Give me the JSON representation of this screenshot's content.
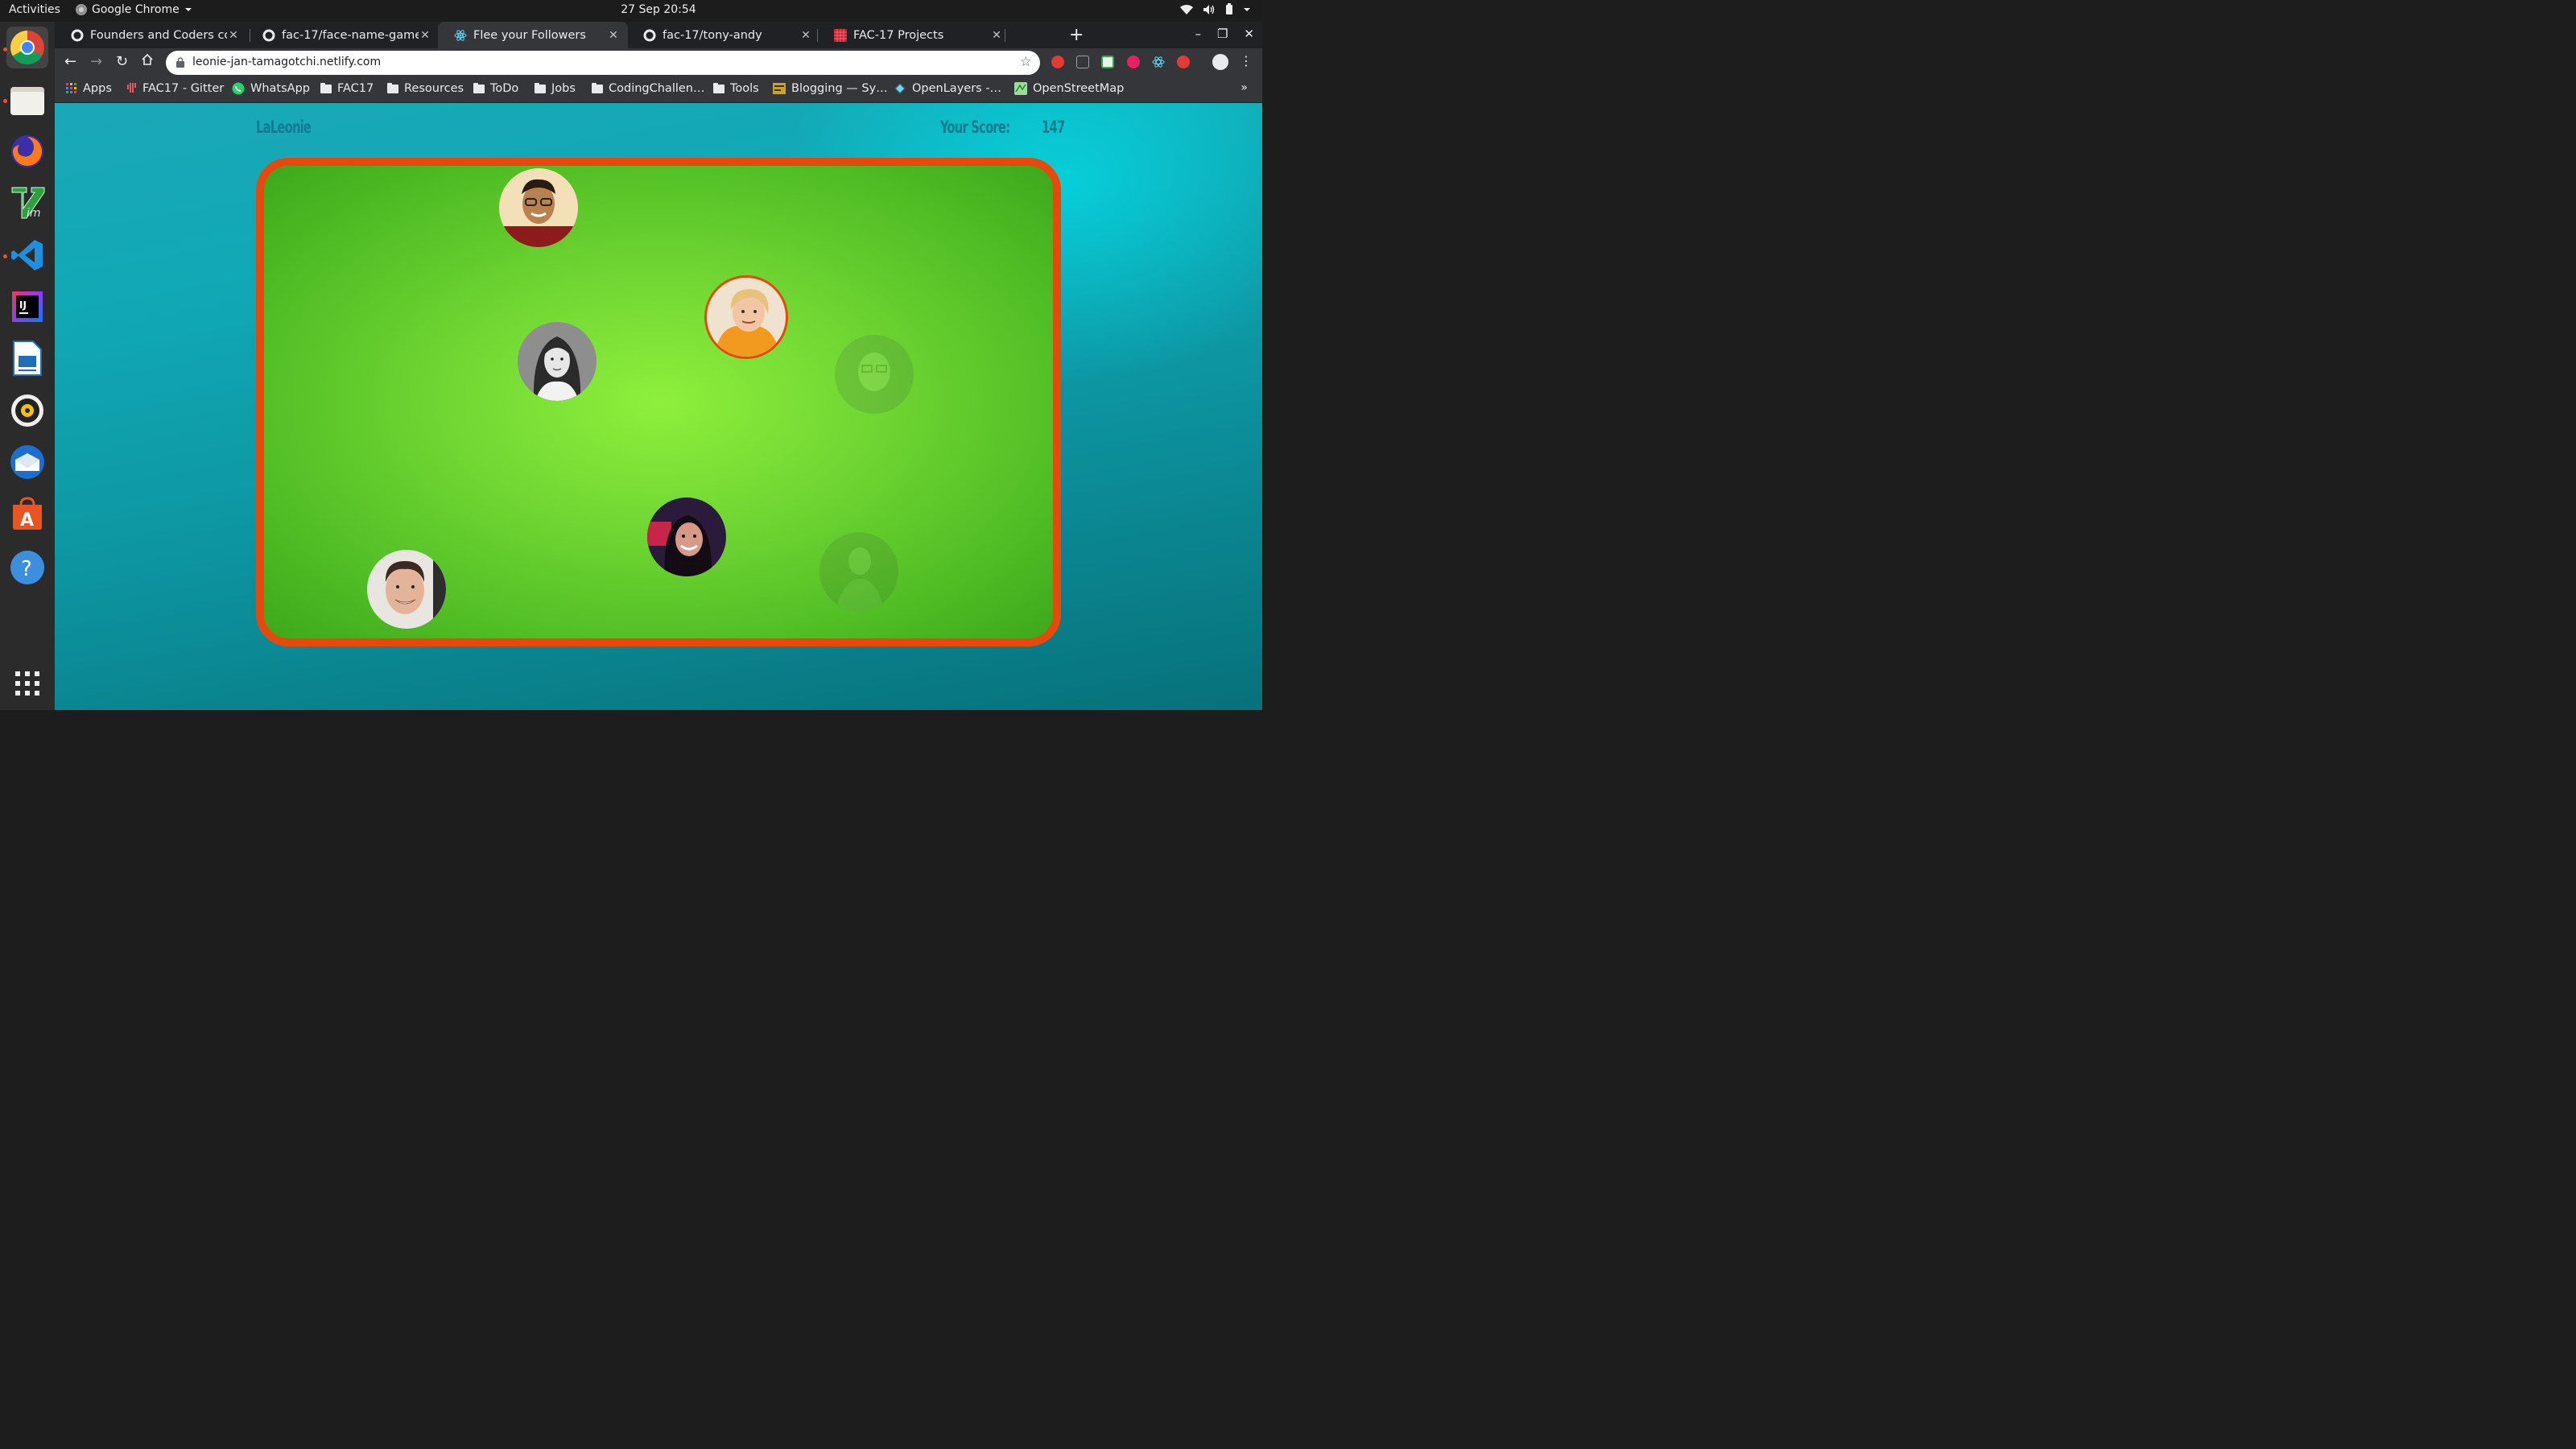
{
  "os": {
    "activities": "Activities",
    "app_name": "Google Chrome",
    "datetime": "27 Sep  20:54"
  },
  "tabs": [
    {
      "title": "Founders and Coders coh",
      "icon": "github-icon",
      "active": false
    },
    {
      "title": "fac-17/face-name-game",
      "icon": "github-icon",
      "active": false
    },
    {
      "title": "Flee your Followers",
      "icon": "react-icon",
      "active": true
    },
    {
      "title": "fac-17/tony-andy",
      "icon": "github-icon",
      "active": false
    },
    {
      "title": "FAC-17 Projects",
      "icon": "grid-icon",
      "active": false
    }
  ],
  "address": {
    "url": "leonie-jan-tamagotchi.netlify.com"
  },
  "bookmarks": [
    {
      "label": "Apps",
      "icon": "apps-grid-icon"
    },
    {
      "label": "FAC17 - Gitter",
      "icon": "gitter-icon"
    },
    {
      "label": "WhatsApp",
      "icon": "whatsapp-icon"
    },
    {
      "label": "FAC17",
      "icon": "folder-icon"
    },
    {
      "label": "Resources",
      "icon": "folder-icon"
    },
    {
      "label": "ToDo",
      "icon": "folder-icon"
    },
    {
      "label": "Jobs",
      "icon": "folder-icon"
    },
    {
      "label": "CodingChallen…",
      "icon": "folder-icon"
    },
    {
      "label": "Tools",
      "icon": "folder-icon"
    },
    {
      "label": "Blogging — Sy…",
      "icon": "blog-icon"
    },
    {
      "label": "OpenLayers -…",
      "icon": "openlayers-icon"
    },
    {
      "label": "OpenStreetMap",
      "icon": "osm-icon"
    }
  ],
  "game": {
    "player": "LaLeonie",
    "score_label": "Your Score:",
    "score": "147"
  },
  "colors": {
    "border": "#e8480c",
    "field": "#6fd532",
    "background": "#0d97a3",
    "header_text": "#117c92"
  }
}
